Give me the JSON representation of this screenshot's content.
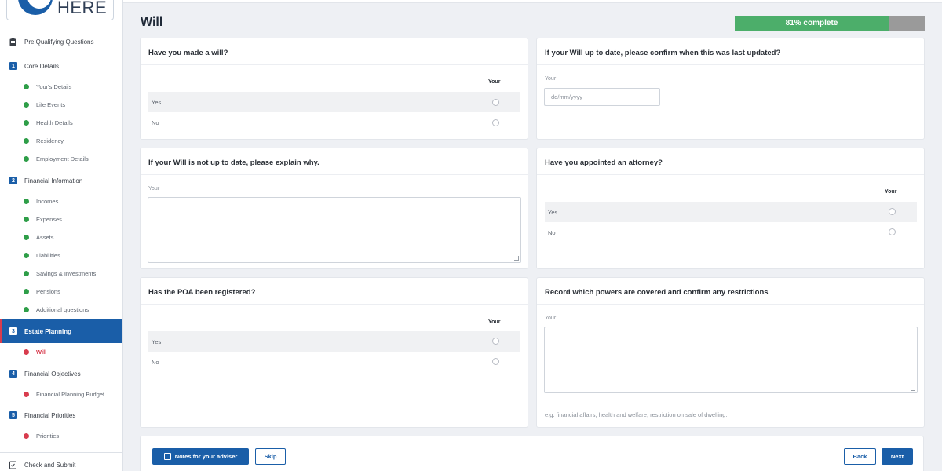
{
  "brand": {
    "logo_text": "HERE"
  },
  "sidebar": {
    "items": [
      {
        "type": "section",
        "icon": "clipboard-icon",
        "label": "Pre Qualifying Questions"
      },
      {
        "type": "section",
        "badge": "1",
        "label": "Core Details"
      },
      {
        "type": "sub",
        "status": "complete",
        "label": "Your's Details"
      },
      {
        "type": "sub",
        "status": "complete",
        "label": "Life Events"
      },
      {
        "type": "sub",
        "status": "complete",
        "label": "Health Details"
      },
      {
        "type": "sub",
        "status": "complete",
        "label": "Residency"
      },
      {
        "type": "sub",
        "status": "complete",
        "label": "Employment Details"
      },
      {
        "type": "section",
        "badge": "2",
        "label": "Financial Information"
      },
      {
        "type": "sub",
        "status": "complete",
        "label": "Incomes"
      },
      {
        "type": "sub",
        "status": "complete",
        "label": "Expenses"
      },
      {
        "type": "sub",
        "status": "complete",
        "label": "Assets"
      },
      {
        "type": "sub",
        "status": "complete",
        "label": "Liabilities"
      },
      {
        "type": "sub",
        "status": "complete",
        "label": "Savings & Investments"
      },
      {
        "type": "sub",
        "status": "complete",
        "label": "Pensions"
      },
      {
        "type": "sub",
        "status": "complete",
        "label": "Additional questions"
      },
      {
        "type": "section",
        "badge": "3",
        "label": "Estate Planning",
        "active": true
      },
      {
        "type": "sub",
        "status": "incomplete",
        "label": "Will",
        "current": true
      },
      {
        "type": "section",
        "badge": "4",
        "label": "Financial Objectives"
      },
      {
        "type": "sub",
        "status": "incomplete",
        "label": "Financial Planning Budget"
      },
      {
        "type": "section",
        "badge": "5",
        "label": "Financial Priorities"
      },
      {
        "type": "sub",
        "status": "incomplete",
        "label": "Priorities"
      },
      {
        "type": "section",
        "icon": "check-square-icon",
        "label": "Check and Submit"
      }
    ]
  },
  "page": {
    "title": "Will",
    "progress": {
      "percent": 81,
      "label": "81% complete"
    }
  },
  "cards": {
    "made_will": {
      "title": "Have you made a will?",
      "column": "Your",
      "options": [
        "Yes",
        "No"
      ]
    },
    "will_updated": {
      "title": "If your Will up to date, please confirm when this was last updated?",
      "field_label": "Your",
      "placeholder": "dd/mm/yyyy"
    },
    "not_up_to_date": {
      "title": "If your Will is not up to date, please explain why.",
      "field_label": "Your"
    },
    "attorney": {
      "title": "Have you appointed an attorney?",
      "column": "Your",
      "options": [
        "Yes",
        "No"
      ]
    },
    "poa_registered": {
      "title": "Has the POA been registered?",
      "column": "Your",
      "options": [
        "Yes",
        "No"
      ]
    },
    "powers": {
      "title": "Record which powers are covered and confirm any restrictions",
      "field_label": "Your",
      "hint": "e.g. financial affairs, health and welfare, restriction on sale of dwelling."
    }
  },
  "footer": {
    "notes_label": "Notes for your adviser",
    "skip_label": "Skip",
    "back_label": "Back",
    "next_label": "Next"
  },
  "colors": {
    "primary": "#1a5ea8",
    "progress_fill": "#4cae6a",
    "complete_dot": "#2e9e48",
    "incomplete_dot": "#d83c4e"
  }
}
